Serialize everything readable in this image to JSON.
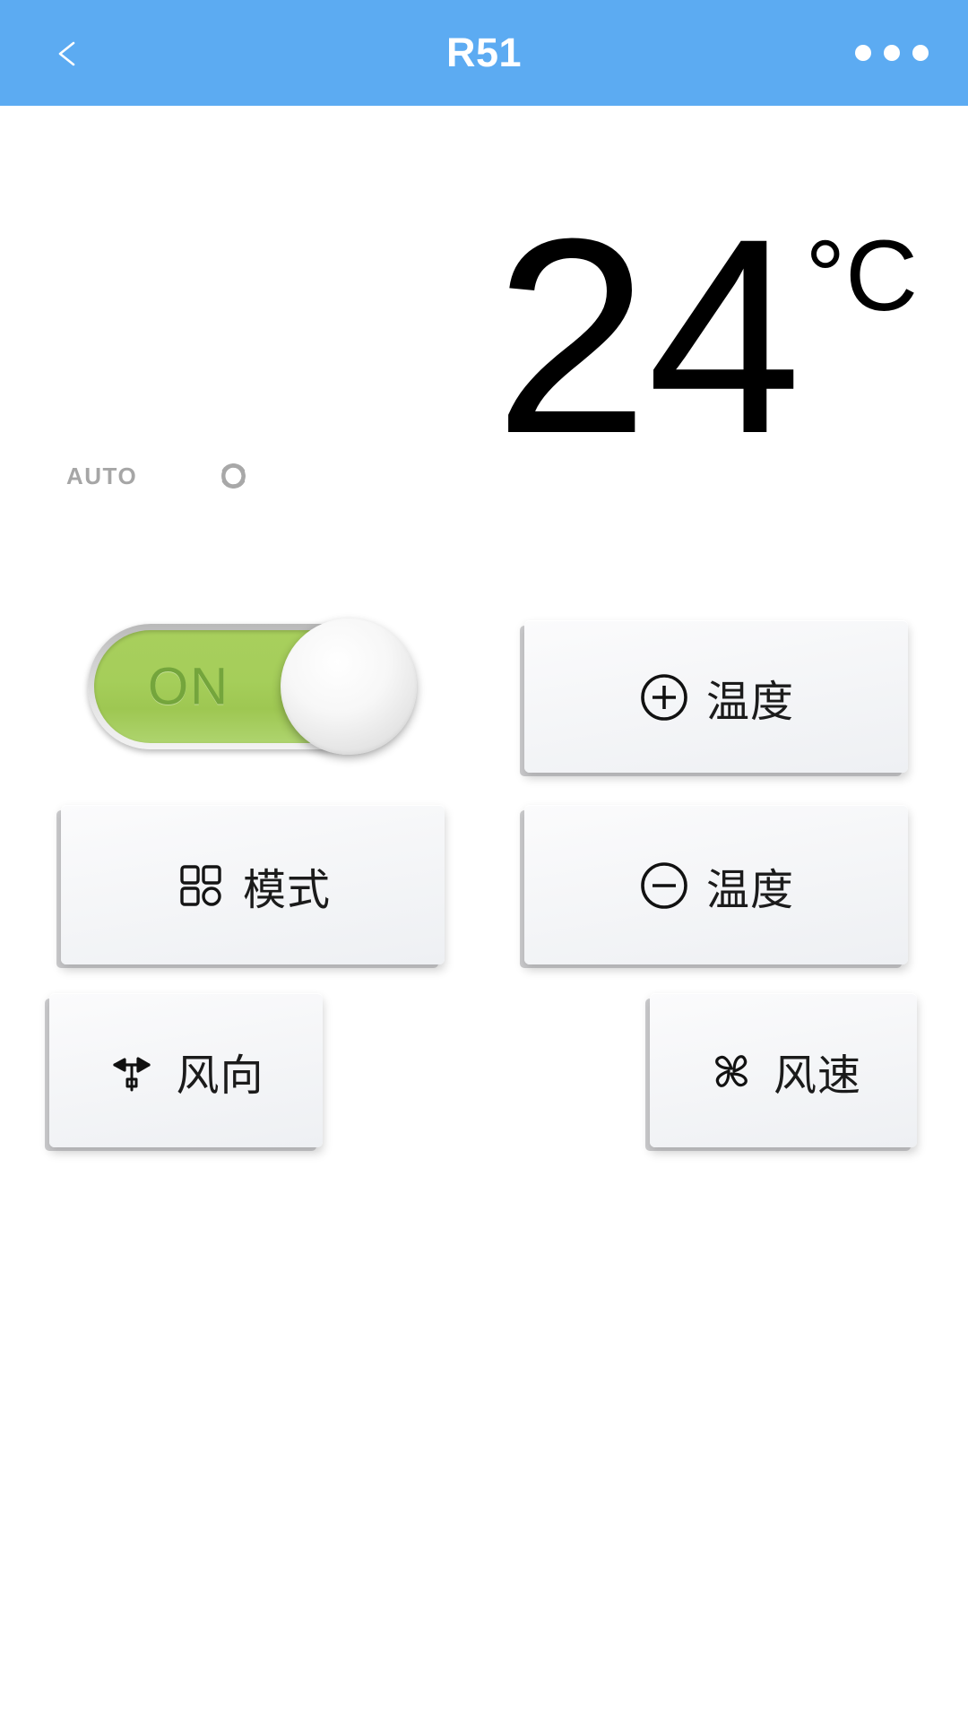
{
  "header": {
    "title": "R51",
    "back_icon": "chevron-left-icon",
    "more_icon": "more-horizontal-icon",
    "background_color": "#5cabf2",
    "text_color": "#ffffff"
  },
  "display": {
    "temperature": "24",
    "unit": "°C",
    "mode_label": "AUTO",
    "mode_icon": "auto-swirl-icon",
    "mode_label_color": "#a6a6a6"
  },
  "power_toggle": {
    "state_label": "ON",
    "is_on": true,
    "track_color": "#a5ce5a",
    "label_color": "#74a53c",
    "knob_color": "#f7f7f7"
  },
  "buttons": [
    {
      "id": "temp-up",
      "label": "温度",
      "icon": "plus-circle-icon"
    },
    {
      "id": "mode",
      "label": "模式",
      "icon": "grid-mode-icon"
    },
    {
      "id": "temp-down",
      "label": "温度",
      "icon": "minus-circle-icon"
    },
    {
      "id": "wind-direction",
      "label": "风向",
      "icon": "weather-vane-icon"
    },
    {
      "id": "fan-speed",
      "label": "风速",
      "icon": "fan-blades-icon"
    }
  ]
}
